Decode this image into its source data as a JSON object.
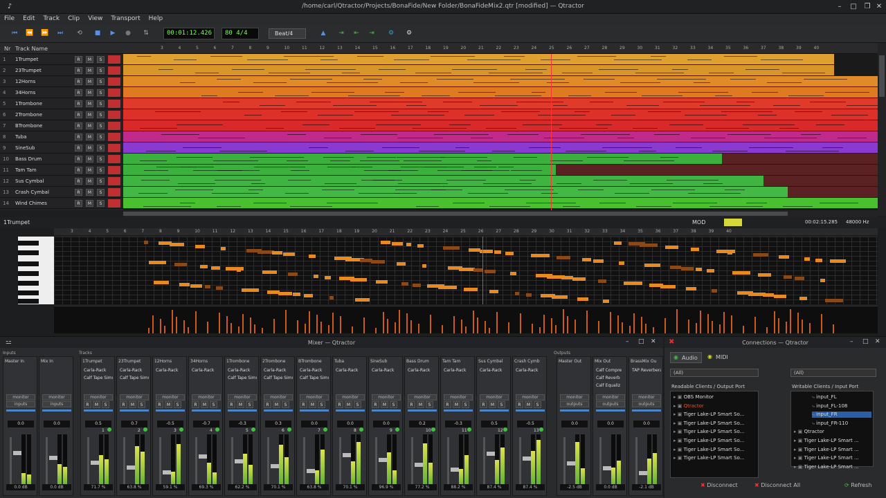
{
  "window": {
    "title": "/home/carl/Qtractor/Projects/BonaFide/New Folder/BonaFideMix2.qtr [modified] — Qtractor"
  },
  "menu": [
    "File",
    "Edit",
    "Track",
    "Clip",
    "View",
    "Transport",
    "Help"
  ],
  "toolbar": {
    "time": "00:01:12.426",
    "tempo": "80 4/4",
    "snap": "Beat/4"
  },
  "tracks": {
    "header_nr": "Nr",
    "header_name": "Track Name",
    "rec_label": "R",
    "mute_label": "M",
    "solo_label": "S",
    "items": [
      {
        "n": "1",
        "name": "1Trumpet"
      },
      {
        "n": "2",
        "name": "23Trumpet"
      },
      {
        "n": "3",
        "name": "12Horns"
      },
      {
        "n": "4",
        "name": "34Horns"
      },
      {
        "n": "5",
        "name": "1Trombone"
      },
      {
        "n": "6",
        "name": "2Trombone"
      },
      {
        "n": "7",
        "name": "BTrombone"
      },
      {
        "n": "8",
        "name": "Tuba"
      },
      {
        "n": "9",
        "name": "SineSub"
      },
      {
        "n": "10",
        "name": "Bass Drum"
      },
      {
        "n": "11",
        "name": "Tam Tam"
      },
      {
        "n": "12",
        "name": "Sus Cymbal"
      },
      {
        "n": "13",
        "name": "Crash Cymbal"
      },
      {
        "n": "14",
        "name": "Wind Chimes"
      }
    ]
  },
  "ruler": {
    "bars": [
      "3",
      "4",
      "5",
      "6",
      "7",
      "8",
      "9",
      "10",
      "11",
      "12",
      "13",
      "14",
      "15",
      "16",
      "17",
      "18",
      "19",
      "20",
      "21",
      "22",
      "23",
      "24",
      "25",
      "26",
      "27",
      "28",
      "29",
      "30",
      "31",
      "32",
      "33",
      "34",
      "35",
      "36",
      "37",
      "38",
      "39",
      "40"
    ]
  },
  "piano": {
    "track": "1Trumpet",
    "mod_label": "MOD",
    "time": "00:02:15.285",
    "rate": "48000 Hz"
  },
  "mixer": {
    "title": "Mixer — Qtractor",
    "inputs_label": "Inputs",
    "tracks_label": "Tracks",
    "outputs_label": "Outputs",
    "monitor_label": "monitor",
    "strips": [
      {
        "name": "Master In",
        "plugins": [],
        "gain": "0.0",
        "btn": "inputs",
        "foot": "0.0 dB"
      },
      {
        "name": "Mix In",
        "plugins": [],
        "gain": "0.0",
        "btn": "inputs",
        "foot": "0.0 dB"
      },
      {
        "name": "1Trumpet",
        "plugins": [
          "Carla-Rack",
          "Calf Tape Simu"
        ],
        "gain": "0.5",
        "num": "1",
        "foot": "71.7 %"
      },
      {
        "name": "23Trumpet",
        "plugins": [
          "Carla-Rack",
          "Calf Tape Simu"
        ],
        "gain": "0.7",
        "num": "2",
        "foot": "63.8 %"
      },
      {
        "name": "12Horns",
        "plugins": [
          "Carla-Rack"
        ],
        "gain": "-0.5",
        "num": "3",
        "foot": "59.1 %"
      },
      {
        "name": "34Horns",
        "plugins": [
          "Carla-Rack"
        ],
        "gain": "-0.7",
        "num": "4",
        "foot": "69.3 %"
      },
      {
        "name": "1Trombone",
        "plugins": [
          "Carla-Rack",
          "Calf Tape Simu"
        ],
        "gain": "-0.3",
        "num": "5",
        "foot": "62.2 %"
      },
      {
        "name": "2Trombone",
        "plugins": [
          "Carla-Rack",
          "Calf Tape Simu"
        ],
        "gain": "0.3",
        "num": "6",
        "foot": "70.1 %"
      },
      {
        "name": "BTrombone",
        "plugins": [
          "Carla-Rack",
          "Calf Tape Simu"
        ],
        "gain": "0.0",
        "num": "7",
        "foot": "63.8 %"
      },
      {
        "name": "Tuba",
        "plugins": [
          "Carla-Rack"
        ],
        "gain": "0.0",
        "num": "8",
        "foot": "70.1 %"
      },
      {
        "name": "SineSub",
        "plugins": [
          "Carla-Rack"
        ],
        "gain": "0.0",
        "num": "9",
        "foot": "96.9 %"
      },
      {
        "name": "Bass Drum",
        "plugins": [
          "Carla-Rack"
        ],
        "gain": "0.2",
        "num": "10",
        "foot": "77.2 %"
      },
      {
        "name": "Tam Tam",
        "plugins": [
          "Carla-Rack"
        ],
        "gain": "-0.3",
        "num": "11",
        "foot": "88.2 %"
      },
      {
        "name": "Sus Cymbal",
        "plugins": [
          "Carla-Rack"
        ],
        "gain": "0.5",
        "num": "12",
        "foot": "87.4 %"
      },
      {
        "name": "Crash Cymb",
        "plugins": [
          "Carla-Rack"
        ],
        "gain": "-0.5",
        "num": "13",
        "foot": "87.4 %"
      },
      {
        "name": "Master Out",
        "plugins": [],
        "gain": "0.0",
        "btn": "outputs",
        "foot": "-2.5 dB"
      },
      {
        "name": "Mix Out",
        "plugins": [
          "Calf Compre",
          "Calf Reverb",
          "Calf Equaliz"
        ],
        "gain": "0.0",
        "btn": "outputs",
        "foot": "0.0 dB"
      },
      {
        "name": "BrassMix Ou",
        "plugins": [
          "TAP Reverbera"
        ],
        "gain": "0.0",
        "btn": "outputs",
        "foot": "-2.1 dB"
      }
    ]
  },
  "connections": {
    "title": "Connections — Qtractor",
    "tab_audio": "Audio",
    "tab_midi": "MIDI",
    "filter_left": "(All)",
    "filter_right": "(All)",
    "readable_header": "Readable Clients / Output Port",
    "writable_header": "Writable Clients / Input Port",
    "readable": [
      "OBS Monitor",
      "Qtractor",
      "Tiger Lake-LP Smart So...",
      "Tiger Lake-LP Smart So...",
      "Tiger Lake-LP Smart So...",
      "Tiger Lake-LP Smart So...",
      "Tiger Lake-LP Smart So...",
      "Tiger Lake-LP Smart So..."
    ],
    "writable": [
      "input_FL",
      "input_FL-108",
      "input_FR",
      "input_FR-110",
      "Qtractor",
      "Tiger Lake-LP Smart ...",
      "Tiger Lake-LP Smart ...",
      "Tiger Lake-LP Smart ...",
      "Tiger Lake-LP Smart ..."
    ],
    "disconnect": "Disconnect",
    "disconnect_all": "Disconnect All",
    "refresh": "Refresh"
  }
}
